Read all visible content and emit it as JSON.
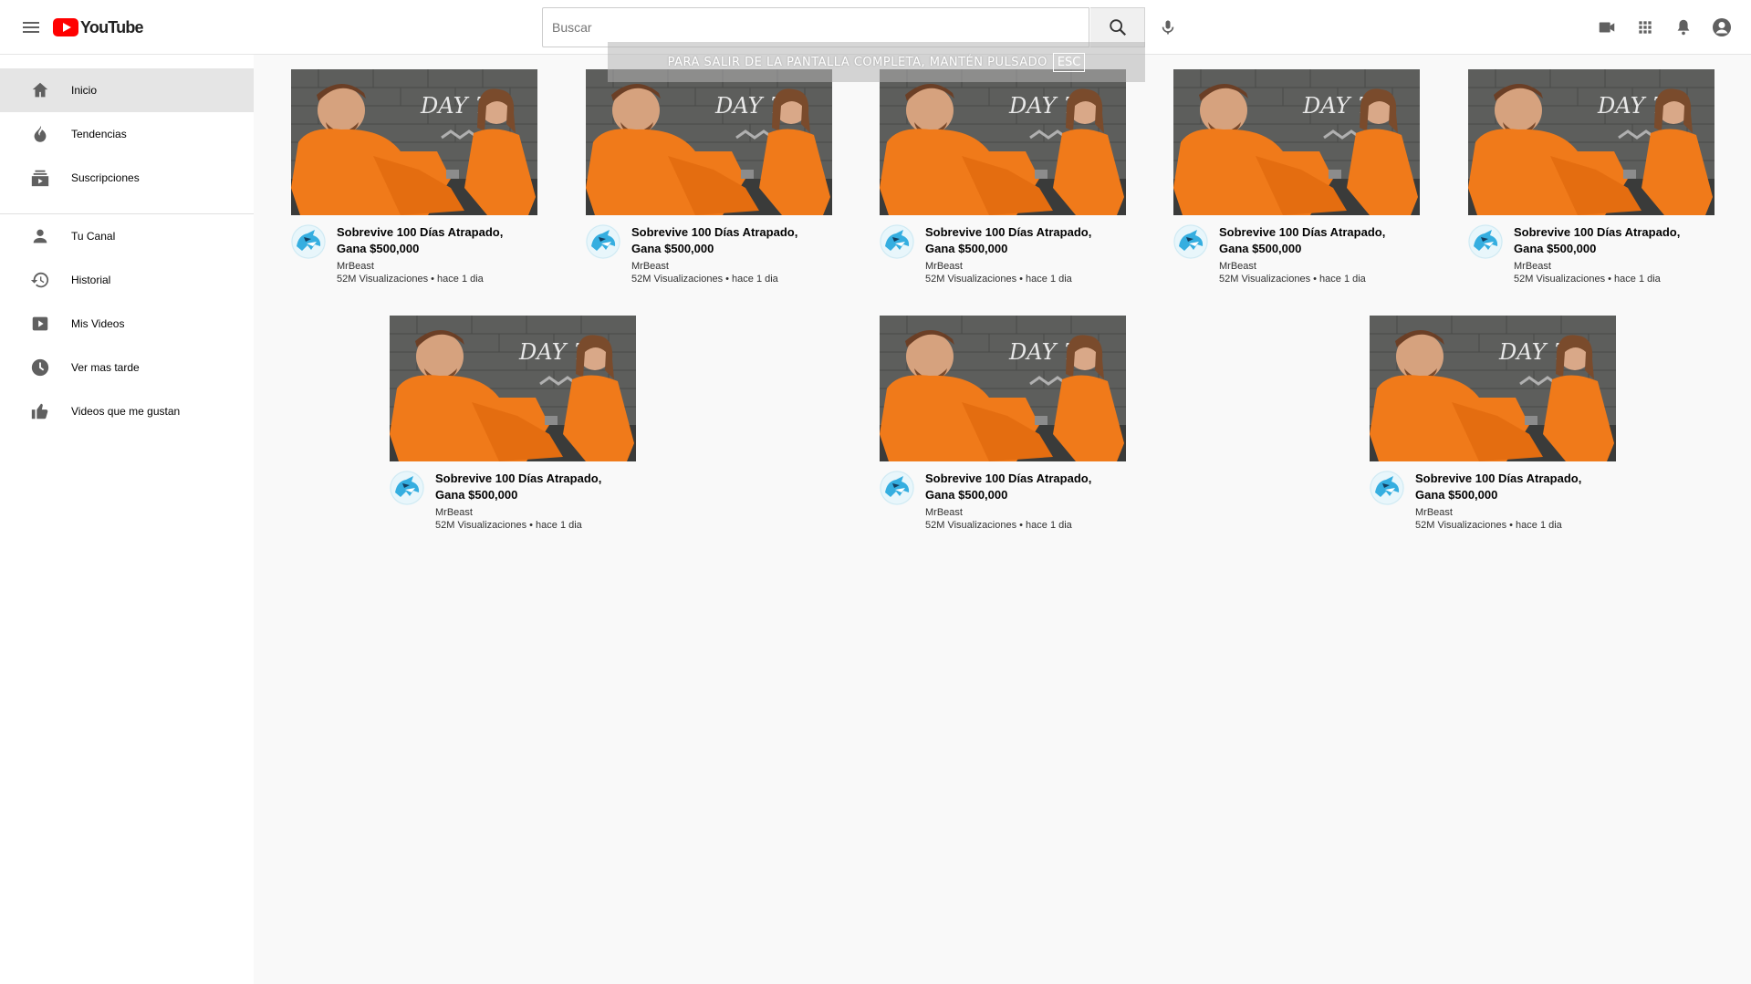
{
  "header": {
    "logo_text": "YouTube",
    "search_placeholder": "Buscar",
    "icons": [
      "menu-icon",
      "search-icon",
      "mic-icon",
      "video-camera-icon",
      "apps-grid-icon",
      "bell-icon",
      "account-icon"
    ]
  },
  "fullscreen_banner": {
    "text": "PARA SALIR DE LA PANTALLA COMPLETA, MANTÉN PULSADO",
    "key": "ESC"
  },
  "sidebar": {
    "items": [
      {
        "label": "Inicio",
        "icon": "home-icon",
        "active": true
      },
      {
        "label": "Tendencias",
        "icon": "fire-icon"
      },
      {
        "label": "Suscripciones",
        "icon": "subscriptions-icon"
      },
      {
        "label": "Tu Canal",
        "icon": "person-icon"
      },
      {
        "label": "Historial",
        "icon": "history-icon"
      },
      {
        "label": "Mis Videos",
        "icon": "play-icon"
      },
      {
        "label": "Ver mas tarde",
        "icon": "clock-icon"
      },
      {
        "label": "Videos que me gustan",
        "icon": "thumbs-up-icon"
      }
    ]
  },
  "videos": [
    {
      "title": "Sobrevive 100 Días Atrapado, Gana $500,000",
      "channel": "MrBeast",
      "meta": "52M Visualizaciones • hace 1 dia",
      "thumb_text": "DAY 70"
    },
    {
      "title": "Sobrevive 100 Días Atrapado, Gana $500,000",
      "channel": "MrBeast",
      "meta": "52M Visualizaciones • hace 1 dia",
      "thumb_text": "DAY 70"
    },
    {
      "title": "Sobrevive 100 Días Atrapado, Gana $500,000",
      "channel": "MrBeast",
      "meta": "52M Visualizaciones • hace 1 dia",
      "thumb_text": "DAY 70"
    },
    {
      "title": "Sobrevive 100 Días Atrapado, Gana $500,000",
      "channel": "MrBeast",
      "meta": "52M Visualizaciones • hace 1 dia",
      "thumb_text": "DAY 70"
    },
    {
      "title": "Sobrevive 100 Días Atrapado, Gana $500,000",
      "channel": "MrBeast",
      "meta": "52M Visualizaciones • hace 1 dia",
      "thumb_text": "DAY 70"
    },
    {
      "title": "Sobrevive 100 Días Atrapado, Gana $500,000",
      "channel": "MrBeast",
      "meta": "52M Visualizaciones • hace 1 dia",
      "thumb_text": "DAY 70"
    },
    {
      "title": "Sobrevive 100 Días Atrapado, Gana $500,000",
      "channel": "MrBeast",
      "meta": "52M Visualizaciones • hace 1 dia",
      "thumb_text": "DAY 70"
    },
    {
      "title": "Sobrevive 100 Días Atrapado, Gana $500,000",
      "channel": "MrBeast",
      "meta": "52M Visualizaciones • hace 1 dia",
      "thumb_text": "DAY 70"
    }
  ],
  "colors": {
    "brand_red": "#ff0000",
    "active_bg": "#e5e5e5",
    "jumpsuit": "#f07a1a",
    "wall": "#5a5a5a"
  }
}
